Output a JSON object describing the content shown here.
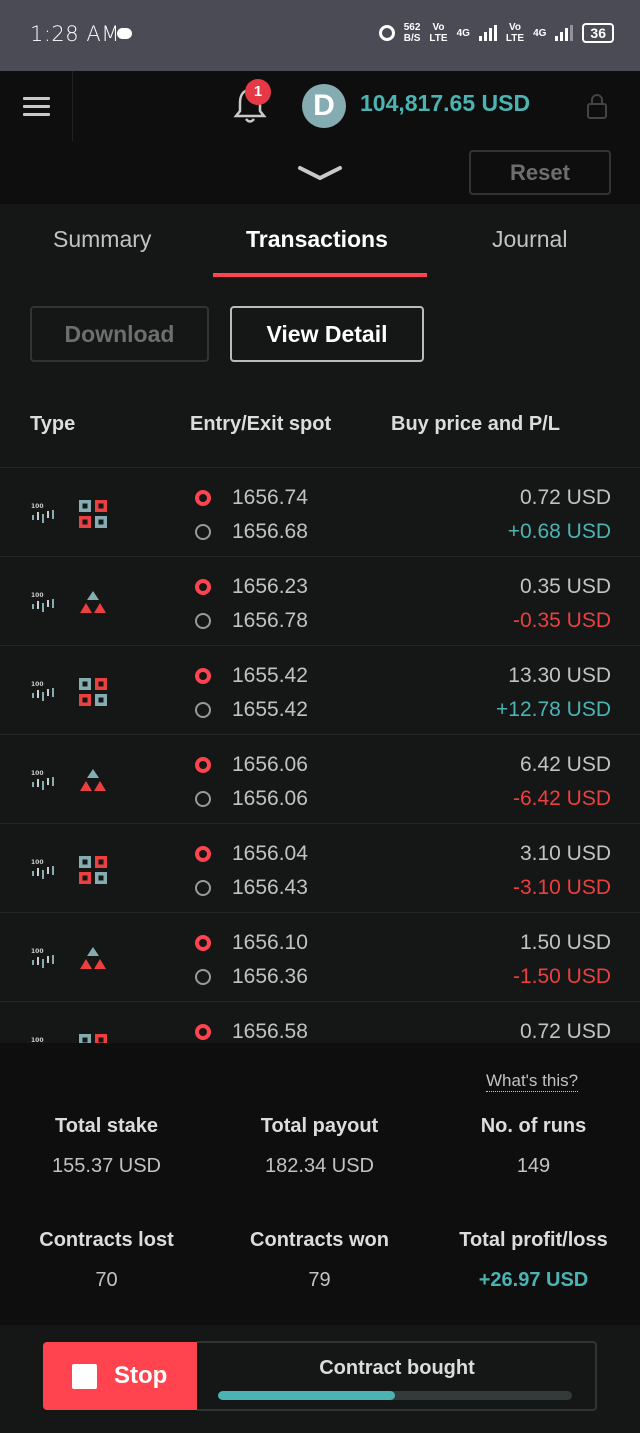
{
  "status_bar": {
    "time": "1:28 AM",
    "speed_value": "562",
    "speed_unit": "B/S",
    "net1_top": "Vo",
    "net1_bottom": "LTE",
    "net2_top": "4G",
    "net3_top": "Vo",
    "net3_bottom": "LTE",
    "net4_top": "4G",
    "battery": "36"
  },
  "header": {
    "notification_count": "1",
    "currency_icon_letter": "D",
    "balance": "104,817.65 USD"
  },
  "controls": {
    "reset_label": "Reset"
  },
  "tabs": [
    {
      "label": "Summary"
    },
    {
      "label": "Transactions"
    },
    {
      "label": "Journal"
    }
  ],
  "actions": {
    "download_label": "Download",
    "view_detail_label": "View Detail"
  },
  "table": {
    "headers": {
      "type": "Type",
      "spot": "Entry/Exit spot",
      "price": "Buy price and P/L"
    },
    "tick_label": "100",
    "rows": [
      {
        "icon": "squares-icon",
        "entry": "1656.74",
        "exit": "1656.68",
        "price": "0.72 USD",
        "pl": "+0.68 USD",
        "pl_sign": "pos"
      },
      {
        "icon": "triangles-icon",
        "entry": "1656.23",
        "exit": "1656.78",
        "price": "0.35 USD",
        "pl": "-0.35 USD",
        "pl_sign": "neg"
      },
      {
        "icon": "squares-icon",
        "entry": "1655.42",
        "exit": "1655.42",
        "price": "13.30 USD",
        "pl": "+12.78 USD",
        "pl_sign": "pos"
      },
      {
        "icon": "triangles-icon",
        "entry": "1656.06",
        "exit": "1656.06",
        "price": "6.42 USD",
        "pl": "-6.42 USD",
        "pl_sign": "neg"
      },
      {
        "icon": "squares-icon",
        "entry": "1656.04",
        "exit": "1656.43",
        "price": "3.10 USD",
        "pl": "-3.10 USD",
        "pl_sign": "neg"
      },
      {
        "icon": "triangles-icon",
        "entry": "1656.10",
        "exit": "1656.36",
        "price": "1.50 USD",
        "pl": "-1.50 USD",
        "pl_sign": "neg"
      },
      {
        "icon": "squares-icon",
        "entry": "1656.58",
        "exit": "",
        "price": "0.72 USD",
        "pl": "",
        "pl_sign": "pos"
      }
    ]
  },
  "summary": {
    "whats_this": "What's this?",
    "total_stake_label": "Total stake",
    "total_stake": "155.37 USD",
    "total_payout_label": "Total payout",
    "total_payout": "182.34 USD",
    "runs_label": "No. of runs",
    "runs": "149",
    "lost_label": "Contracts lost",
    "lost": "70",
    "won_label": "Contracts won",
    "won": "79",
    "profit_label": "Total profit/loss",
    "profit": "+26.97 USD"
  },
  "footer": {
    "stop_label": "Stop",
    "status": "Contract bought",
    "progress": 0.5
  },
  "colors": {
    "accent_teal": "#4bb4b3",
    "accent_red": "#ff444f",
    "loss_red": "#ec3f3f"
  }
}
